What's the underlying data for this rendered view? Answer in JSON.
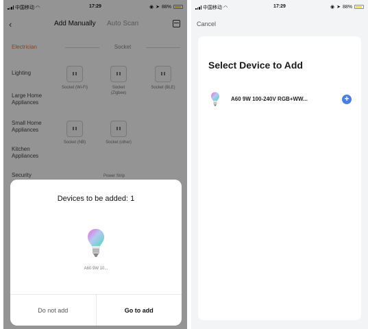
{
  "left": {
    "status": {
      "carrier": "中国移动",
      "time": "17:29",
      "battery": "88%"
    },
    "nav": {
      "tab_manual": "Add Manually",
      "tab_scan": "Auto Scan"
    },
    "categories": [
      {
        "label": "Electrician",
        "active": true
      },
      {
        "label": "Lighting"
      },
      {
        "label": "Large Home Appliances"
      },
      {
        "label": "Small Home Appliances"
      },
      {
        "label": "Kitchen Appliances"
      },
      {
        "label": "Security"
      }
    ],
    "section_title": "Socket",
    "devices": [
      {
        "label": "Socket (Wi-Fi)"
      },
      {
        "label": "Socket (Zigbee)"
      },
      {
        "label": "Socket (BLE)"
      },
      {
        "label": "Socket (NB)"
      },
      {
        "label": "Socket (other)"
      }
    ],
    "power_strip_label": "Power Strip",
    "sheet": {
      "title": "Devices to be added: 1",
      "device_name": "A60 9W 10...",
      "btn_no": "Do not add",
      "btn_go": "Go to add"
    }
  },
  "right": {
    "status": {
      "carrier": "中国移动",
      "time": "17:29",
      "battery": "88%"
    },
    "cancel": "Cancel",
    "heading": "Select Device to Add",
    "device": {
      "name": "A60 9W 100-240V RGB+WW...",
      "icon": "bulb-icon"
    },
    "add_icon": "plus-circle-icon"
  },
  "colors": {
    "accent": "#4a7fe0",
    "active_category": "#e8743b",
    "battery": "#f5d027"
  }
}
